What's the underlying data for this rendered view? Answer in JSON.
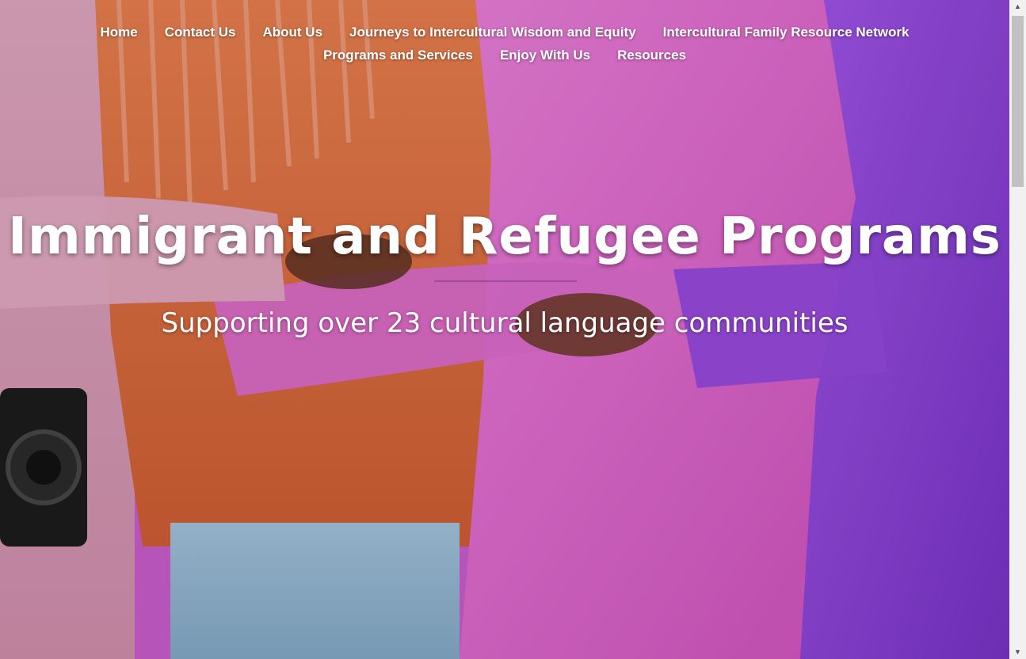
{
  "nav": {
    "row1": [
      {
        "label": "Home"
      },
      {
        "label": "Contact Us"
      },
      {
        "label": "About Us"
      },
      {
        "label": "Journeys to Intercultural Wisdom and Equity"
      },
      {
        "label": "Intercultural Family Resource Network"
      }
    ],
    "row2": [
      {
        "label": "Programs and Services"
      },
      {
        "label": "Enjoy With Us"
      },
      {
        "label": "Resources"
      }
    ]
  },
  "hero": {
    "title": "Immigrant and Refugee Programs",
    "subtitle": "Supporting over 23 cultural language communities",
    "image_description_icon": "people-embracing-photo"
  },
  "colors": {
    "pink_sweater": "#d85fc6",
    "orange_jacket": "#d4693f",
    "purple_coat": "#8a3fd1",
    "light_pink_sleeve": "#d99ab5",
    "denim": "#8fb3cc",
    "text": "#ffffff"
  },
  "scrollbar": {
    "up_icon": "triangle-up-icon",
    "down_icon": "triangle-down-icon"
  }
}
